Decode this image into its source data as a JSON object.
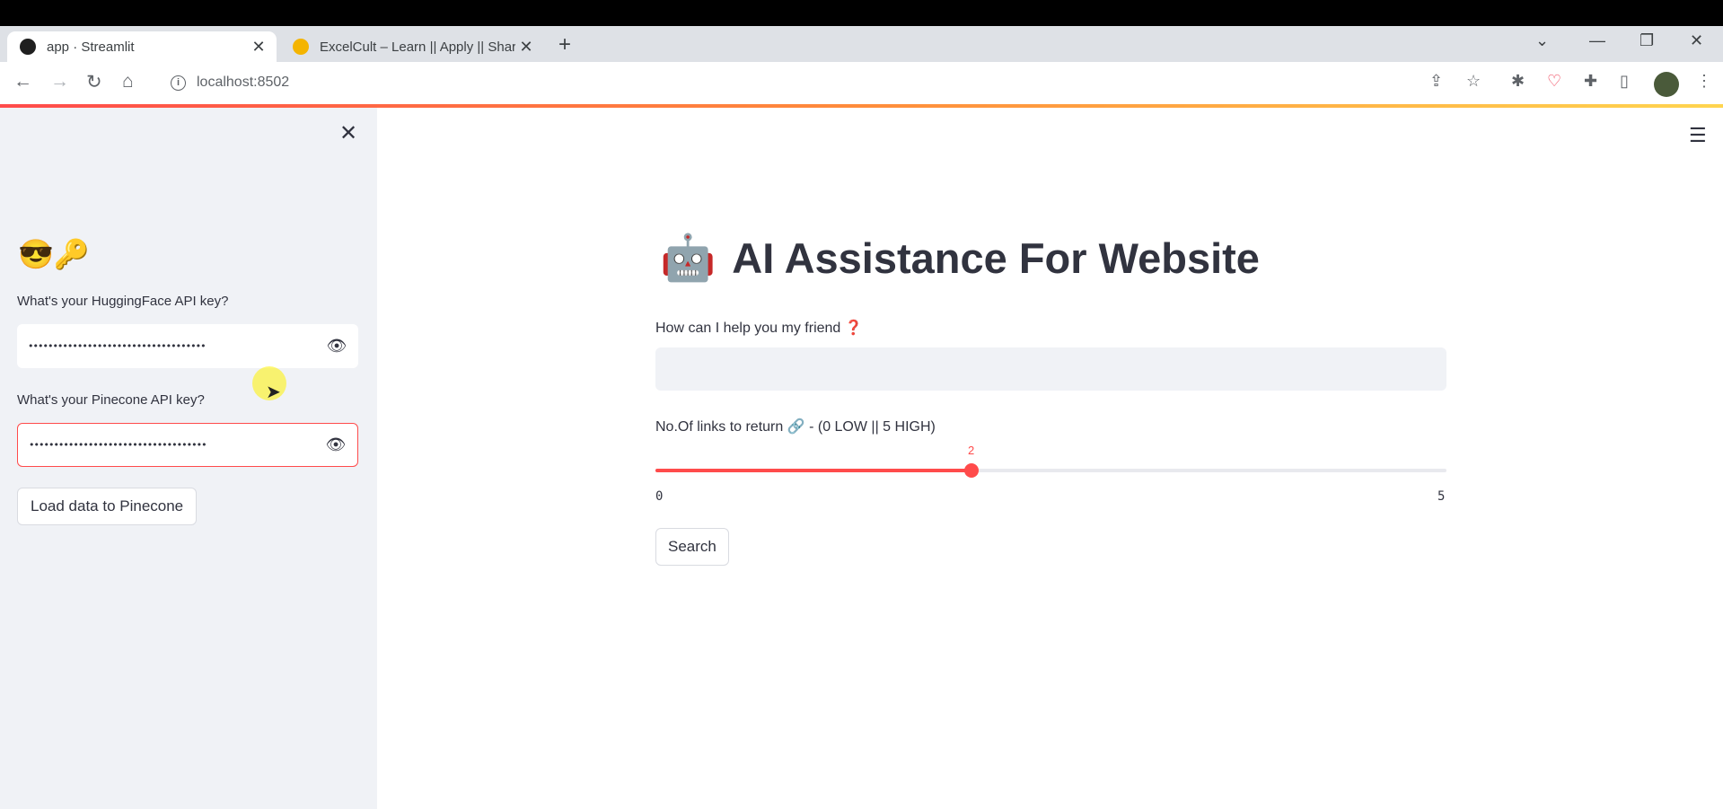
{
  "browser": {
    "tabs": [
      {
        "label": "app · Streamlit",
        "active": true
      },
      {
        "label": "ExcelCult – Learn || Apply || Share",
        "active": false
      }
    ],
    "address": "localhost:8502",
    "icons": {
      "back": "back-arrow-icon",
      "forward": "forward-arrow-icon",
      "reload": "reload-icon",
      "home": "home-icon",
      "share": "share-icon",
      "bookmark": "star-icon",
      "extensions": "puzzle-icon"
    },
    "colors": {
      "accent": "#ff4b4b"
    }
  },
  "sidebar": {
    "emoji": "😎🔑",
    "hf_label": "What's your HuggingFace API key?",
    "hf_value": "••••••••••••••••••••••••••••••••••••",
    "pinecone_label": "What's your Pinecone API key?",
    "pinecone_value": "••••••••••••••••••••••••••••••••••••",
    "load_button": "Load data to Pinecone"
  },
  "main": {
    "robot_emoji": "🤖",
    "title": "AI Assistance For Website",
    "question_label": "How can I help you my friend ❓",
    "question_value": "",
    "slider": {
      "label": "No.Of links to return 🔗 - (0 LOW || 5 HIGH)",
      "value": 2,
      "min": 0,
      "max": 5,
      "value_text": "2",
      "min_text": "0",
      "max_text": "5"
    },
    "search_button": "Search"
  }
}
